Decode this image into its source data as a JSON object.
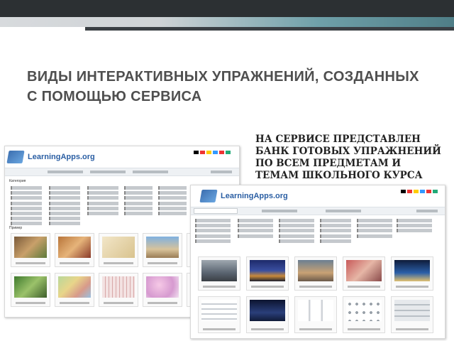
{
  "slide": {
    "title": "Виды интерактивных упражнений, созданных с помощью сервиса",
    "note": "На сервисе представлен банк готовых упражнений по всем предметам и темам школьного курса"
  },
  "screenshot_1": {
    "logo": "LearningApps.org",
    "category_label": "Категория",
    "example_label": "Пример"
  },
  "screenshot_2": {
    "logo": "LearningApps.org"
  },
  "colors": {
    "title": "#4f4f4f",
    "top_band": "#2c3033",
    "accent_teal": "#5f909a"
  }
}
